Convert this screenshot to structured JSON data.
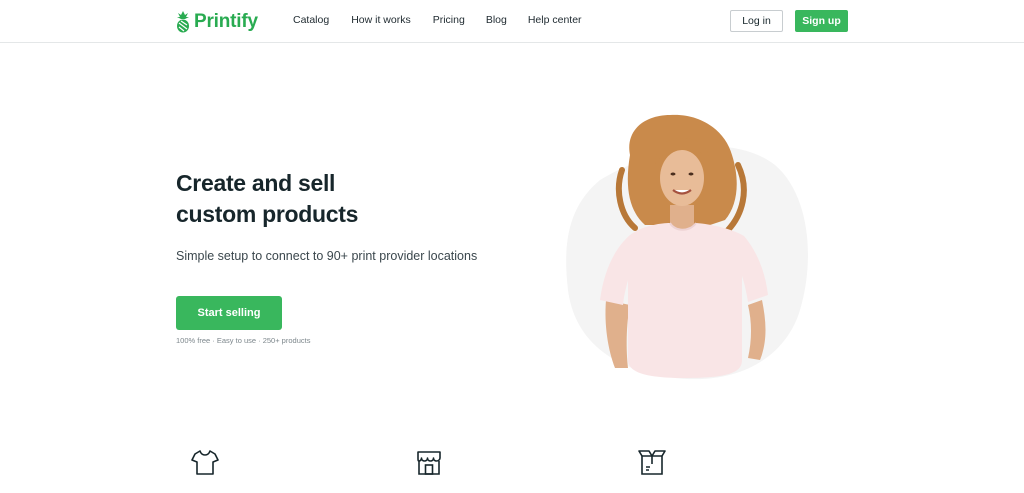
{
  "brand": {
    "name": "Printify",
    "color": "#29ab51",
    "logo_icon": "pineapple-icon"
  },
  "nav": {
    "items": [
      {
        "label": "Catalog"
      },
      {
        "label": "How it works"
      },
      {
        "label": "Pricing"
      },
      {
        "label": "Blog"
      },
      {
        "label": "Help center"
      }
    ]
  },
  "auth": {
    "login_label": "Log in",
    "signup_label": "Sign up"
  },
  "hero": {
    "title_line1": "Create and sell",
    "title_line2": "custom products",
    "subtitle": "Simple setup to connect to 90+ print provider locations",
    "cta_label": "Start selling",
    "note": "100% free · Easy to use · 250+ products",
    "image": "woman-in-pink-tshirt-photo"
  },
  "features": {
    "icons": [
      "tshirt-icon",
      "storefront-icon",
      "shipping-box-icon"
    ]
  },
  "colors": {
    "accent": "#39b75d",
    "text": "#17262b",
    "blob": "#f4f4f4"
  }
}
